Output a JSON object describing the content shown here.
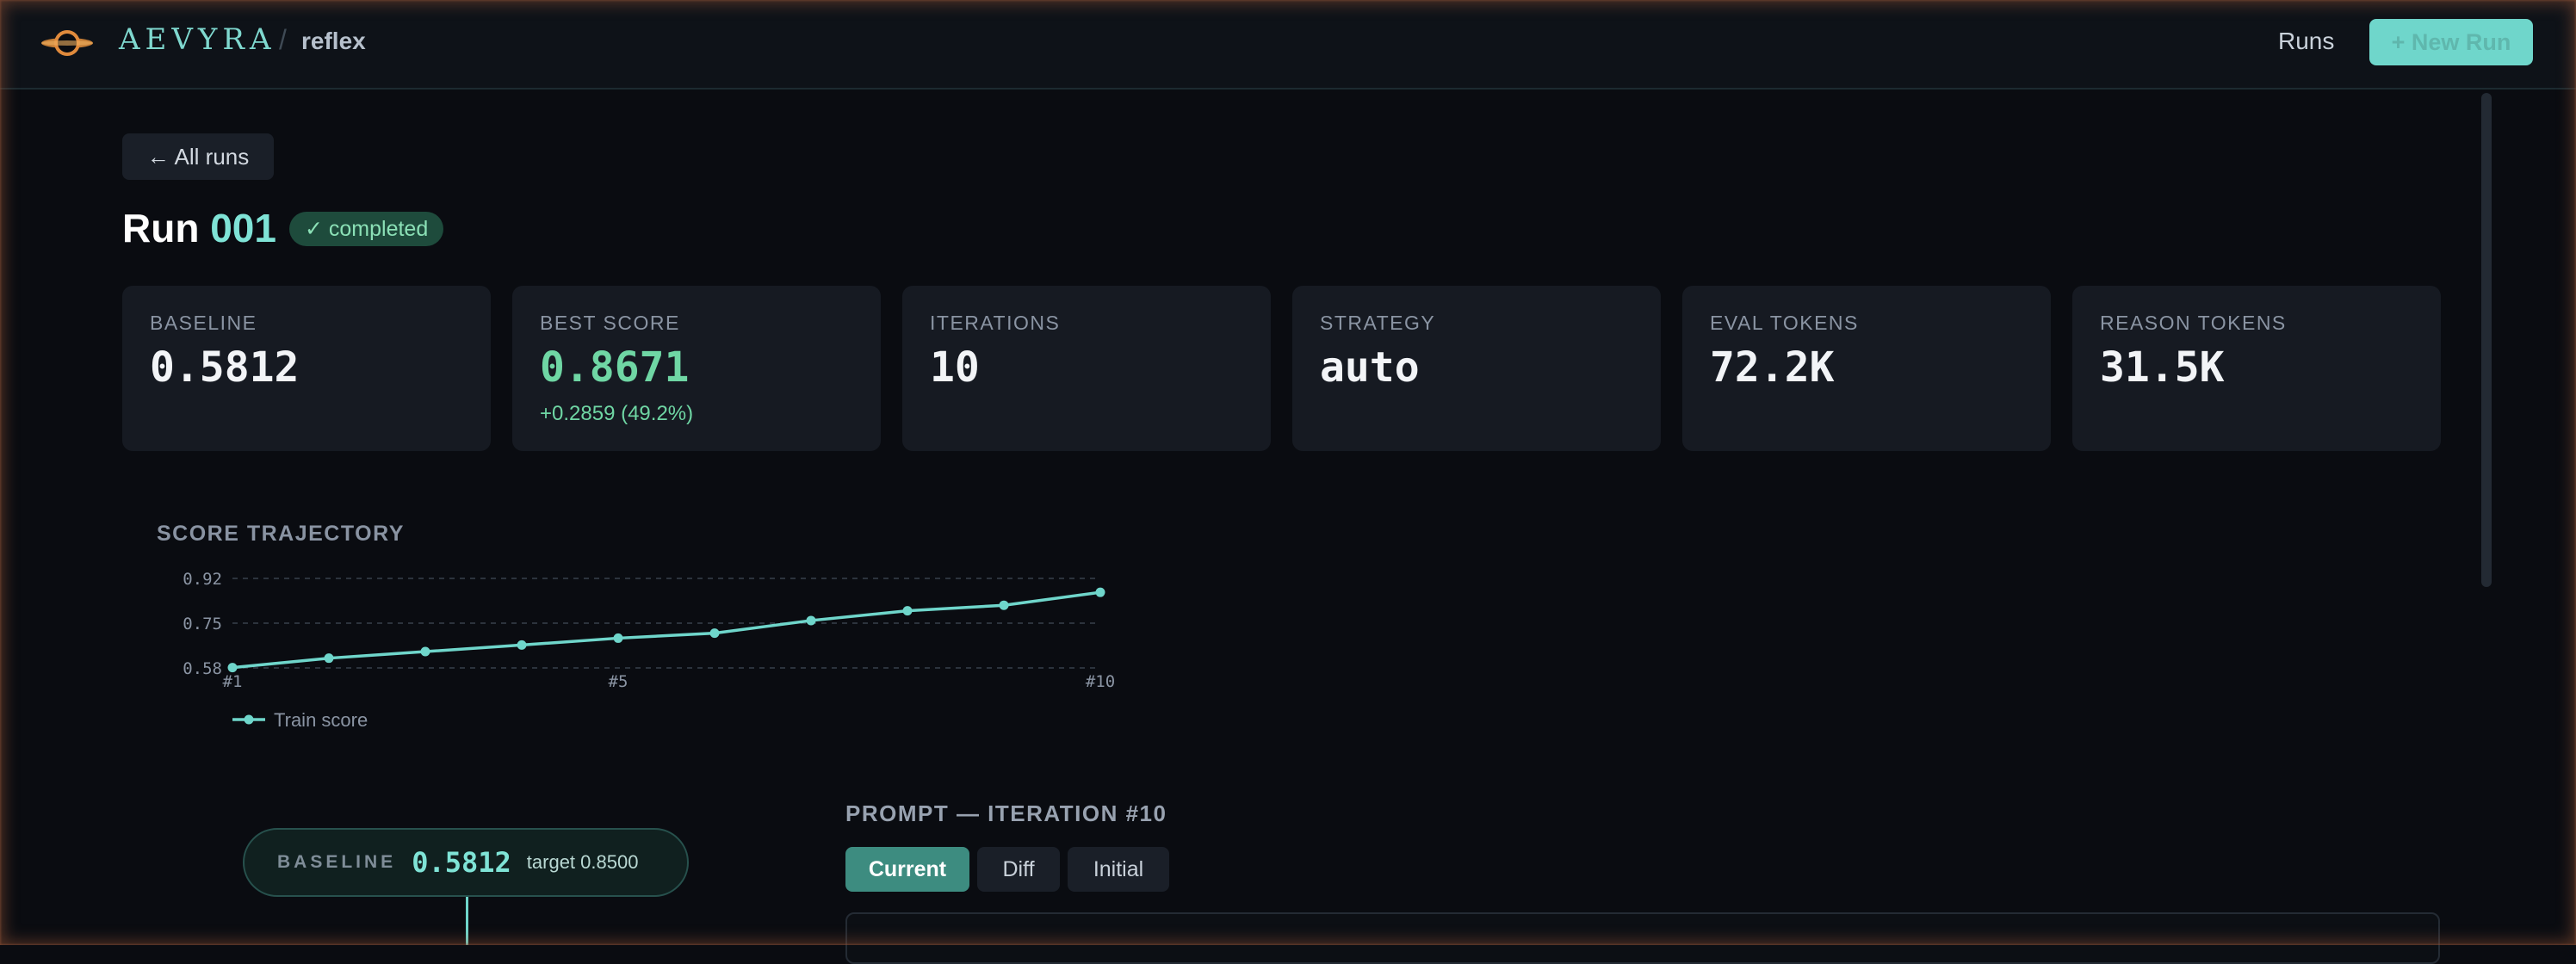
{
  "header": {
    "brand": "AEVYRA",
    "separator": "/",
    "project": "reflex",
    "nav_runs": "Runs",
    "new_run_label": "+ New Run"
  },
  "back_label": "← All runs",
  "run": {
    "title_prefix": "Run",
    "number": "001",
    "status": "✓ completed"
  },
  "stats": [
    {
      "label": "BASELINE",
      "value": "0.5812",
      "sub": ""
    },
    {
      "label": "BEST SCORE",
      "value": "0.8671",
      "sub": "+0.2859 (49.2%)"
    },
    {
      "label": "ITERATIONS",
      "value": "10",
      "sub": ""
    },
    {
      "label": "STRATEGY",
      "value": "auto",
      "sub": ""
    },
    {
      "label": "EVAL TOKENS",
      "value": "72.2K",
      "sub": ""
    },
    {
      "label": "REASON TOKENS",
      "value": "31.5K",
      "sub": ""
    }
  ],
  "chart_title": "SCORE TRAJECTORY",
  "chart_data": {
    "type": "line",
    "x": [
      "#1",
      "#2",
      "#3",
      "#4",
      "#5",
      "#6",
      "#7",
      "#8",
      "#9",
      "#10"
    ],
    "x_tick_labels": [
      "#1",
      "#5",
      "#10"
    ],
    "y_tick_labels": [
      "0.92",
      "0.75",
      "0.58"
    ],
    "ylim": [
      0.58,
      0.92
    ],
    "grid": true,
    "legend_position": "bottom-left",
    "series": [
      {
        "name": "Train score",
        "color": "#6fd6cb",
        "values": [
          0.5812,
          0.617,
          0.642,
          0.667,
          0.693,
          0.712,
          0.76,
          0.797,
          0.818,
          0.8671
        ]
      }
    ]
  },
  "baseline_pill": {
    "label": "BASELINE",
    "value": "0.5812",
    "target": "target 0.8500"
  },
  "prompt": {
    "title": "PROMPT — ITERATION #10",
    "tabs": [
      "Current",
      "Diff",
      "Initial"
    ]
  },
  "colors": {
    "accent": "#6fd6cb",
    "success": "#6fd6a4",
    "background": "#0a0c11",
    "card": "#161a22"
  }
}
